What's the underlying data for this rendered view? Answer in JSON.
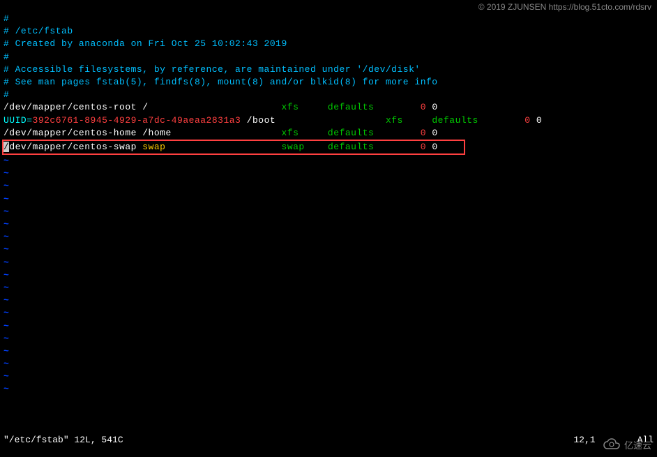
{
  "watermark": "© 2019 ZJUNSEN https://blog.51cto.com/rdsrv",
  "fstab": {
    "comments": [
      "#",
      "# /etc/fstab",
      "# Created by anaconda on Fri Oct 25 10:02:43 2019",
      "#",
      "# Accessible filesystems, by reference, are maintained under '/dev/disk'",
      "# See man pages fstab(5), findfs(8), mount(8) and/or blkid(8) for more info",
      "#"
    ],
    "entries": [
      {
        "device": "/dev/mapper/centos-root",
        "mount": "/",
        "fs": "xfs",
        "opts": "defaults",
        "dump": "0",
        "pass": "0"
      },
      {
        "uuid_prefix": "UUID=",
        "uuid": "392c6761-8945-4929-a7dc-49aeaa2831a3",
        "mount": "/boot",
        "fs": "xfs",
        "opts": "defaults",
        "dump": "0",
        "pass": "0"
      },
      {
        "device": "/dev/mapper/centos-home",
        "mount": "/home",
        "fs": "xfs",
        "opts": "defaults",
        "dump": "0",
        "pass": "0"
      },
      {
        "device_first": "/",
        "device_rest": "dev/mapper/centos-swap",
        "mount": "swap",
        "fs": "swap",
        "opts": "defaults",
        "dump": "0",
        "pass": "0"
      }
    ]
  },
  "tilde": "~",
  "status": {
    "left": "\"/etc/fstab\" 12L, 541C",
    "pos": "12,1",
    "scroll": "All"
  },
  "logo_text": "亿速云"
}
